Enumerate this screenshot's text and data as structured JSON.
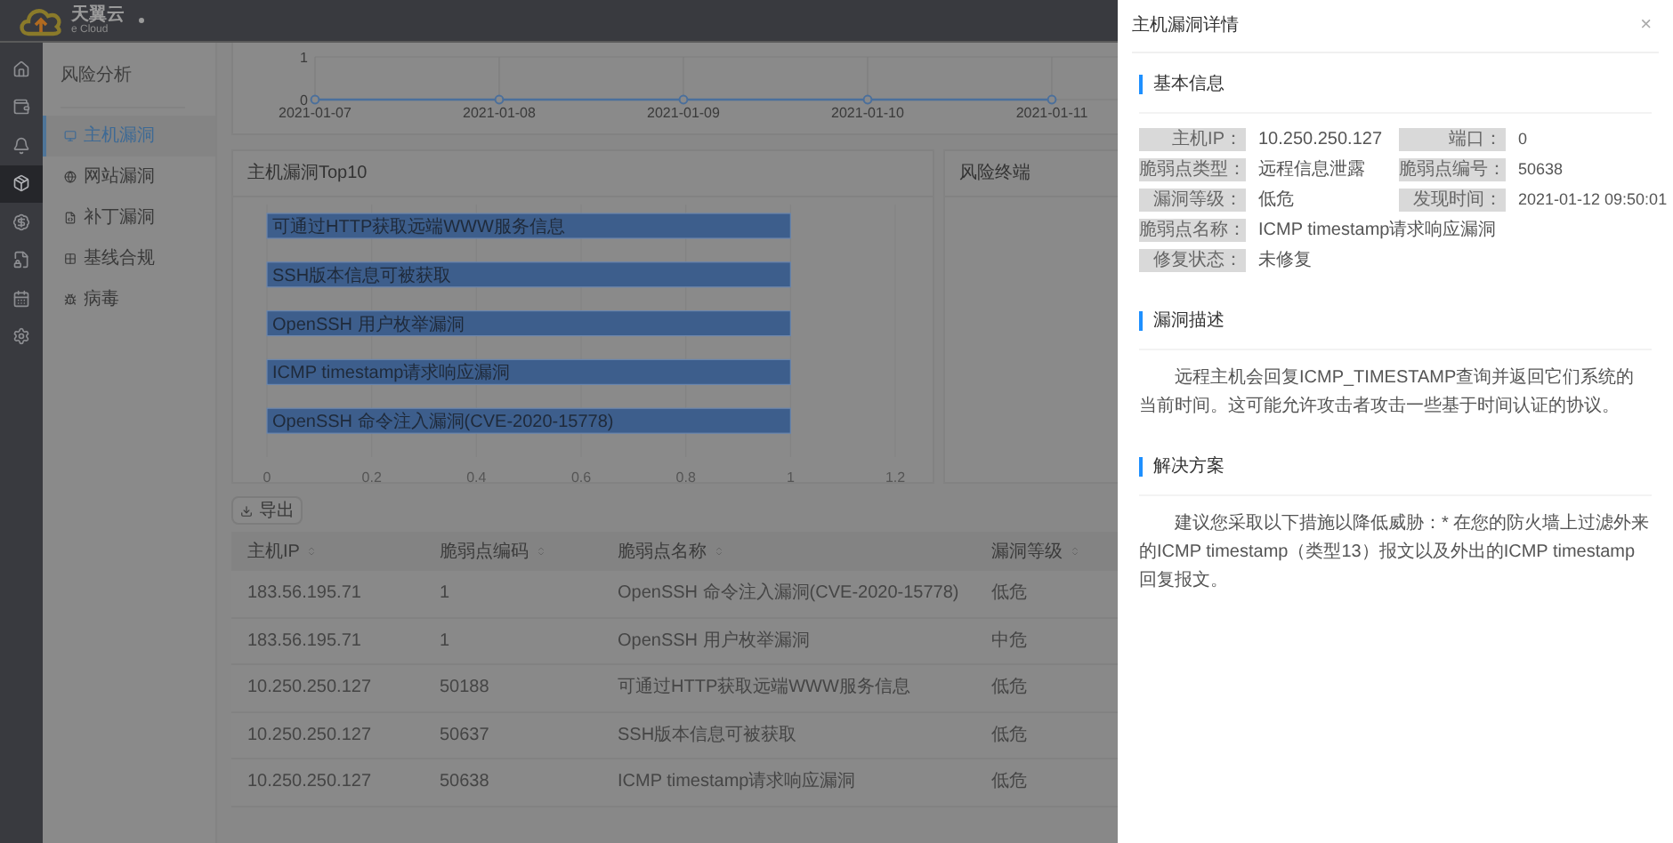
{
  "brand": {
    "name": "天翼云",
    "sub": "e Cloud"
  },
  "rail": [
    {
      "kind": "home",
      "selected": false
    },
    {
      "kind": "wallet",
      "selected": false
    },
    {
      "kind": "bell",
      "selected": false
    },
    {
      "kind": "cube",
      "selected": true
    },
    {
      "kind": "money",
      "selected": false
    },
    {
      "kind": "doc",
      "selected": false
    },
    {
      "kind": "calendar",
      "selected": false
    },
    {
      "kind": "settings",
      "selected": false
    }
  ],
  "submenu": {
    "title": "风险分析",
    "items": [
      {
        "label": "主机漏洞",
        "kind": "monitor",
        "selected": true
      },
      {
        "label": "网站漏洞",
        "kind": "globe",
        "selected": false
      },
      {
        "label": "补丁漏洞",
        "kind": "patch",
        "selected": false
      },
      {
        "label": "基线合规",
        "kind": "grid",
        "selected": false
      },
      {
        "label": "病毒",
        "kind": "bug",
        "selected": false
      }
    ]
  },
  "trend": {
    "chart_data": {
      "type": "line",
      "categories": [
        "2021-01-07",
        "2021-01-08",
        "2021-01-09",
        "2021-01-10",
        "2021-01-11"
      ],
      "yticks": [
        0,
        1
      ],
      "ylim": [
        0,
        1
      ],
      "grid": true,
      "series": [
        {
          "color": "#4a6f9c",
          "marker": true,
          "values": [
            0,
            0,
            0,
            0,
            0
          ]
        }
      ]
    }
  },
  "top10": {
    "title": "主机漏洞Top10",
    "chart_data": {
      "type": "bar",
      "orientation": "horizontal",
      "categories": [
        "可通过HTTP获取远端WWW服务信息",
        "SSH版本信息可被获取",
        "OpenSSH 用户枚举漏洞",
        "ICMP timestamp请求响应漏洞",
        "OpenSSH 命令注入漏洞(CVE-2020-15778)"
      ],
      "xticks": [
        0,
        0.2,
        0.4,
        0.6,
        0.8,
        1,
        1.2
      ],
      "xlim": [
        0,
        1.2
      ],
      "grid": true,
      "series": [
        {
          "color": "#3d5e8c",
          "values": [
            1,
            1,
            1,
            1,
            1
          ]
        }
      ]
    }
  },
  "terminal": {
    "title": "风险终端"
  },
  "export_button": "导出",
  "table": {
    "columns": [
      "主机IP",
      "脆弱点编码",
      "脆弱点名称",
      "漏洞等级"
    ],
    "rows": [
      [
        "183.56.195.71",
        "1",
        "OpenSSH 命令注入漏洞(CVE-2020-15778)",
        "低危"
      ],
      [
        "183.56.195.71",
        "1",
        "OpenSSH 用户枚举漏洞",
        "中危"
      ],
      [
        "10.250.250.127",
        "50188",
        "可通过HTTP获取远端WWW服务信息",
        "低危"
      ],
      [
        "10.250.250.127",
        "50637",
        "SSH版本信息可被获取",
        "低危"
      ],
      [
        "10.250.250.127",
        "50638",
        "ICMP timestamp请求响应漏洞",
        "低危"
      ]
    ]
  },
  "drawer": {
    "title": "主机漏洞详情",
    "close": "×",
    "basic": {
      "title": "基本信息",
      "rows": [
        [
          {
            "label": "主机IP：",
            "value": "10.250.250.127"
          },
          {
            "label": "端口：",
            "value": "0"
          }
        ],
        [
          {
            "label": "脆弱点类型：",
            "value": "远程信息泄露"
          },
          {
            "label": "脆弱点编号：",
            "value": "50638"
          }
        ],
        [
          {
            "label": "漏洞等级：",
            "value": "低危"
          },
          {
            "label": "发现时间：",
            "value": "2021-01-12 09:50:01"
          }
        ],
        [
          {
            "label": "脆弱点名称：",
            "value": "ICMP timestamp请求响应漏洞"
          }
        ],
        [
          {
            "label": "修复状态：",
            "value": "未修复"
          }
        ]
      ]
    },
    "description": {
      "title": "漏洞描述",
      "text": "远程主机会回复ICMP_TIMESTAMP查询并返回它们系统的当前时间。这可能允许攻击者攻击一些基于时间认证的协议。"
    },
    "solution": {
      "title": "解决方案",
      "text": "建议您采取以下措施以降低威胁：* 在您的防火墙上过滤外来的ICMP timestamp（类型13）报文以及外出的ICMP timestamp回复报文。"
    }
  }
}
